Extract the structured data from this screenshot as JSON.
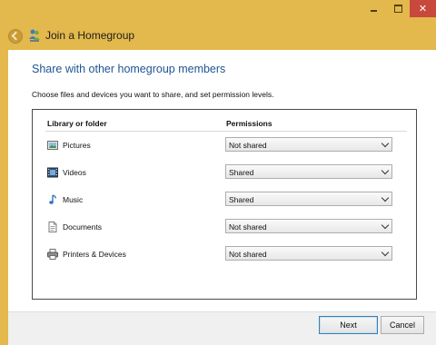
{
  "window": {
    "controls": {
      "minimize_icon": "minimize-icon",
      "maximize_icon": "maximize-icon",
      "close_icon": "close-icon",
      "close_glyph": "✕"
    }
  },
  "navigation": {
    "back_icon": "back-arrow-icon",
    "app_icon": "homegroup-icon",
    "title": "Join a Homegroup"
  },
  "content": {
    "heading": "Share with other homegroup members",
    "instruction": "Choose files and devices you want to share, and set permission levels.",
    "columns": {
      "library": "Library or folder",
      "permissions": "Permissions"
    },
    "rows": [
      {
        "icon": "pictures-icon",
        "label": "Pictures",
        "permission": "Not shared"
      },
      {
        "icon": "videos-icon",
        "label": "Videos",
        "permission": "Shared"
      },
      {
        "icon": "music-icon",
        "label": "Music",
        "permission": "Shared"
      },
      {
        "icon": "documents-icon",
        "label": "Documents",
        "permission": "Not shared"
      },
      {
        "icon": "printers-icon",
        "label": "Printers & Devices",
        "permission": "Not shared"
      }
    ]
  },
  "footer": {
    "next_label": "Next",
    "cancel_label": "Cancel"
  },
  "colors": {
    "window_frame": "#e3b84c",
    "heading": "#1e5494",
    "close_button": "#c9483c"
  }
}
